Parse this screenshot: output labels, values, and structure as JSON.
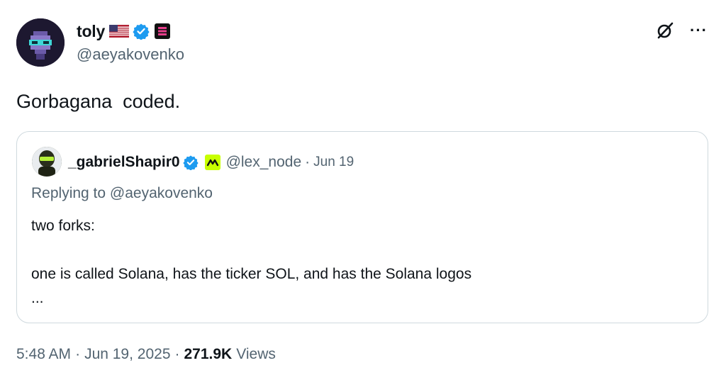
{
  "author": {
    "display_name": "toly",
    "handle": "@aeyakovenko",
    "flag_icon": "us-flag-icon",
    "verified_color": "#1d9bf0",
    "affiliation_icon": "solana-affiliate-badge-icon"
  },
  "header_icons": {
    "grok": "grok-icon",
    "more": "···"
  },
  "tweet": {
    "text": "Gorbagana  coded."
  },
  "quoted_tweet": {
    "display_name": "_gabrielShapir0",
    "handle": "@lex_node",
    "dot": "·",
    "date": "Jun 19",
    "replying_prefix": "Replying to ",
    "replying_to": "@aeyakovenko",
    "lines": [
      "two forks:",
      "",
      "one is called Solana, has the ticker SOL, and has the Solana logos",
      "..."
    ],
    "affiliation_color": "#c8ff00"
  },
  "meta": {
    "time": "5:48 AM",
    "sep1": "·",
    "date": "Jun 19, 2025",
    "sep2": "·",
    "views_count": "271.9K",
    "views_label": "Views"
  }
}
